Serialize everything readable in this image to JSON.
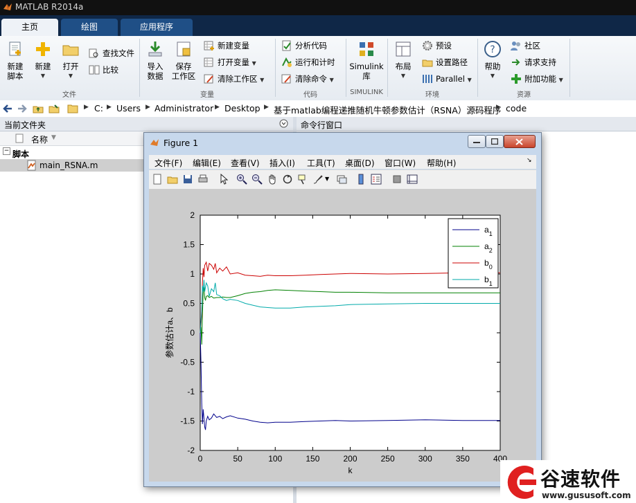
{
  "window": {
    "title": "MATLAB R2014a"
  },
  "tabs": [
    {
      "label": "主页"
    },
    {
      "label": "绘图"
    },
    {
      "label": "应用程序"
    }
  ],
  "ribbon": {
    "file": {
      "new_script": "新建\n脚本",
      "new": "新建",
      "open": "打开",
      "find_files": "查找文件",
      "compare": "比较",
      "group": "文件"
    },
    "variable": {
      "import": "导入\n数据",
      "save_ws": "保存\n工作区",
      "new_var": "新建变量",
      "open_var": "打开变量",
      "clear_ws": "清除工作区",
      "group": "变量"
    },
    "code": {
      "analyze": "分析代码",
      "run_time": "运行和计时",
      "clear_cmd": "清除命令",
      "group": "代码"
    },
    "simulink": {
      "lib": "Simulink\n库",
      "group": "SIMULINK"
    },
    "env": {
      "layout": "布局",
      "prefs": "预设",
      "set_path": "设置路径",
      "parallel": "Parallel",
      "group": "环境"
    },
    "resources": {
      "help": "帮助",
      "community": "社区",
      "support": "请求支持",
      "addons": "附加功能",
      "group": "资源"
    }
  },
  "address": {
    "crumbs": [
      "C:",
      "Users",
      "Administrator",
      "Desktop",
      "基于matlab编程递推随机牛顿参数估计（RSNA）源码程序",
      "code"
    ]
  },
  "left_panel": {
    "title": "当前文件夹",
    "col_name": "名称",
    "group": "脚本",
    "file": "main_RSNA.m"
  },
  "right_panel": {
    "title": "命令行窗口"
  },
  "figure": {
    "title": "Figure 1",
    "menu": [
      "文件(F)",
      "编辑(E)",
      "查看(V)",
      "插入(I)",
      "工具(T)",
      "桌面(D)",
      "窗口(W)",
      "帮助(H)"
    ]
  },
  "chart_data": {
    "type": "line",
    "xlabel": "k",
    "ylabel": "参数估计a、b",
    "xlim": [
      0,
      400
    ],
    "ylim": [
      -2,
      2
    ],
    "xticks": [
      0,
      50,
      100,
      150,
      200,
      250,
      300,
      350,
      400
    ],
    "yticks": [
      -2,
      -1.5,
      -1,
      -0.5,
      0,
      0.5,
      1,
      1.5,
      2
    ],
    "legend": "top-right",
    "series": [
      {
        "name": "a1",
        "base": "a",
        "sub": "1",
        "color": "#00008b",
        "x": [
          0,
          1,
          2,
          3,
          4,
          5,
          6,
          7,
          8,
          10,
          12,
          15,
          18,
          22,
          26,
          30,
          35,
          40,
          50,
          60,
          70,
          80,
          90,
          100,
          120,
          140,
          160,
          180,
          200,
          250,
          300,
          350,
          400
        ],
        "y": [
          0,
          -0.5,
          -1.2,
          -1.55,
          -1.3,
          -1.45,
          -1.6,
          -1.65,
          -1.5,
          -1.42,
          -1.48,
          -1.45,
          -1.38,
          -1.44,
          -1.42,
          -1.46,
          -1.43,
          -1.41,
          -1.45,
          -1.47,
          -1.5,
          -1.52,
          -1.53,
          -1.52,
          -1.52,
          -1.51,
          -1.5,
          -1.49,
          -1.5,
          -1.49,
          -1.48,
          -1.49,
          -1.49
        ]
      },
      {
        "name": "a2",
        "base": "a",
        "sub": "2",
        "color": "#008000",
        "x": [
          0,
          1,
          2,
          3,
          4,
          5,
          6,
          7,
          8,
          10,
          12,
          15,
          18,
          22,
          26,
          30,
          35,
          40,
          50,
          60,
          70,
          80,
          90,
          100,
          120,
          140,
          160,
          180,
          200,
          250,
          300,
          350,
          400
        ],
        "y": [
          0,
          0.1,
          -0.2,
          0.3,
          0.7,
          0.78,
          0.6,
          0.55,
          0.62,
          0.63,
          0.6,
          0.62,
          0.59,
          0.6,
          0.6,
          0.61,
          0.6,
          0.6,
          0.63,
          0.67,
          0.69,
          0.7,
          0.72,
          0.73,
          0.72,
          0.71,
          0.7,
          0.69,
          0.69,
          0.68,
          0.68,
          0.68,
          0.68
        ]
      },
      {
        "name": "b0",
        "base": "b",
        "sub": "0",
        "color": "#cc0000",
        "x": [
          0,
          2,
          3,
          4,
          5,
          6,
          8,
          10,
          12,
          15,
          18,
          20,
          22,
          26,
          30,
          35,
          40,
          50,
          60,
          70,
          80,
          90,
          100,
          120,
          140,
          160,
          180,
          200,
          250,
          300,
          350,
          400
        ],
        "y": [
          0,
          0.3,
          0.85,
          1.1,
          0.95,
          1.15,
          1.2,
          1.05,
          1.18,
          1.15,
          1.08,
          1.18,
          1.02,
          1.1,
          1.05,
          1.12,
          1.0,
          1.02,
          0.98,
          0.97,
          0.96,
          0.98,
          0.97,
          0.97,
          0.98,
          0.99,
          1.0,
          1.01,
          1.0,
          1.01,
          1.02,
          1.02
        ]
      },
      {
        "name": "b1",
        "base": "b",
        "sub": "1",
        "color": "#00aaaa",
        "x": [
          0,
          2,
          3,
          4,
          5,
          6,
          8,
          10,
          12,
          15,
          18,
          20,
          22,
          26,
          30,
          35,
          40,
          50,
          60,
          70,
          80,
          90,
          100,
          120,
          140,
          160,
          180,
          200,
          250,
          300,
          350,
          400
        ],
        "y": [
          0,
          0.4,
          0.8,
          0.7,
          0.9,
          0.7,
          0.85,
          0.8,
          0.62,
          0.75,
          0.7,
          0.85,
          0.65,
          0.63,
          0.58,
          0.55,
          0.57,
          0.55,
          0.5,
          0.47,
          0.44,
          0.43,
          0.42,
          0.42,
          0.44,
          0.45,
          0.46,
          0.48,
          0.49,
          0.5,
          0.5,
          0.5
        ]
      }
    ]
  },
  "watermark": {
    "brand": "谷速软件",
    "url": "www.gususoft.com"
  }
}
